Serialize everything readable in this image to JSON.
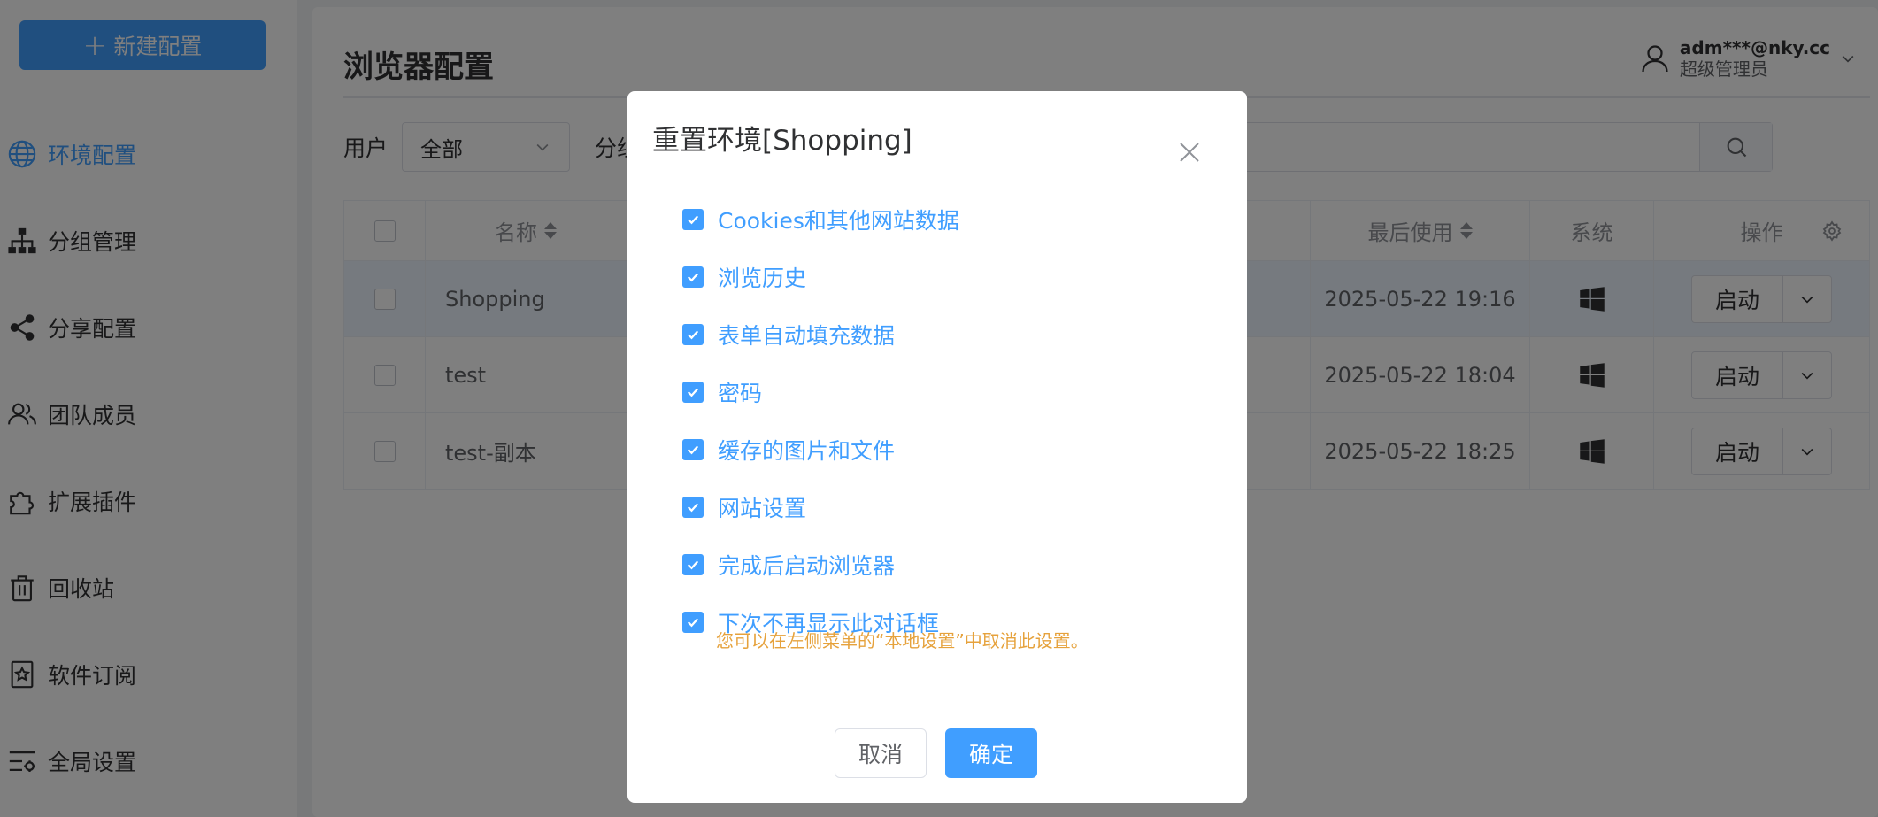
{
  "sidebar": {
    "new_button": "新建配置",
    "items": [
      {
        "label": "环境配置",
        "icon": "globe-icon",
        "active": true
      },
      {
        "label": "分组管理",
        "icon": "org-tree-icon",
        "active": false
      },
      {
        "label": "分享配置",
        "icon": "share-icon",
        "active": false
      },
      {
        "label": "团队成员",
        "icon": "team-icon",
        "active": false
      },
      {
        "label": "扩展插件",
        "icon": "puzzle-icon",
        "active": false
      },
      {
        "label": "回收站",
        "icon": "trash-icon",
        "active": false
      },
      {
        "label": "软件订阅",
        "icon": "subscription-icon",
        "active": false
      },
      {
        "label": "全局设置",
        "icon": "settings-icon",
        "active": false
      }
    ]
  },
  "header": {
    "title": "浏览器配置",
    "user_email": "adm***@nky.cc",
    "user_role": "超级管理员"
  },
  "filters": {
    "user_label": "用户",
    "user_value": "全部",
    "group_label": "分组"
  },
  "table": {
    "columns": {
      "name": "名称",
      "last_used": "最后使用",
      "system": "系统",
      "actions": "操作"
    },
    "rows": [
      {
        "name": "Shopping",
        "last_used": "2025-05-22 19:16",
        "action": "启动"
      },
      {
        "name": "test",
        "last_used": "2025-05-22 18:04",
        "action": "启动"
      },
      {
        "name": "test-副本",
        "last_used": "2025-05-22 18:25",
        "action": "启动"
      }
    ]
  },
  "dialog": {
    "title": "重置环境[Shopping]",
    "options": [
      {
        "label": "Cookies和其他网站数据",
        "checked": true
      },
      {
        "label": "浏览历史",
        "checked": true
      },
      {
        "label": "表单自动填充数据",
        "checked": true
      },
      {
        "label": "密码",
        "checked": true
      },
      {
        "label": "缓存的图片和文件",
        "checked": true
      },
      {
        "label": "网站设置",
        "checked": true
      },
      {
        "label": "完成后启动浏览器",
        "checked": true
      },
      {
        "label": "下次不再显示此对话框",
        "checked": true
      }
    ],
    "hint": "您可以在左侧菜单的“本地设置”中取消此设置。",
    "cancel": "取消",
    "confirm": "确定"
  },
  "colors": {
    "primary": "#409eff",
    "warning": "#e6a23c"
  }
}
